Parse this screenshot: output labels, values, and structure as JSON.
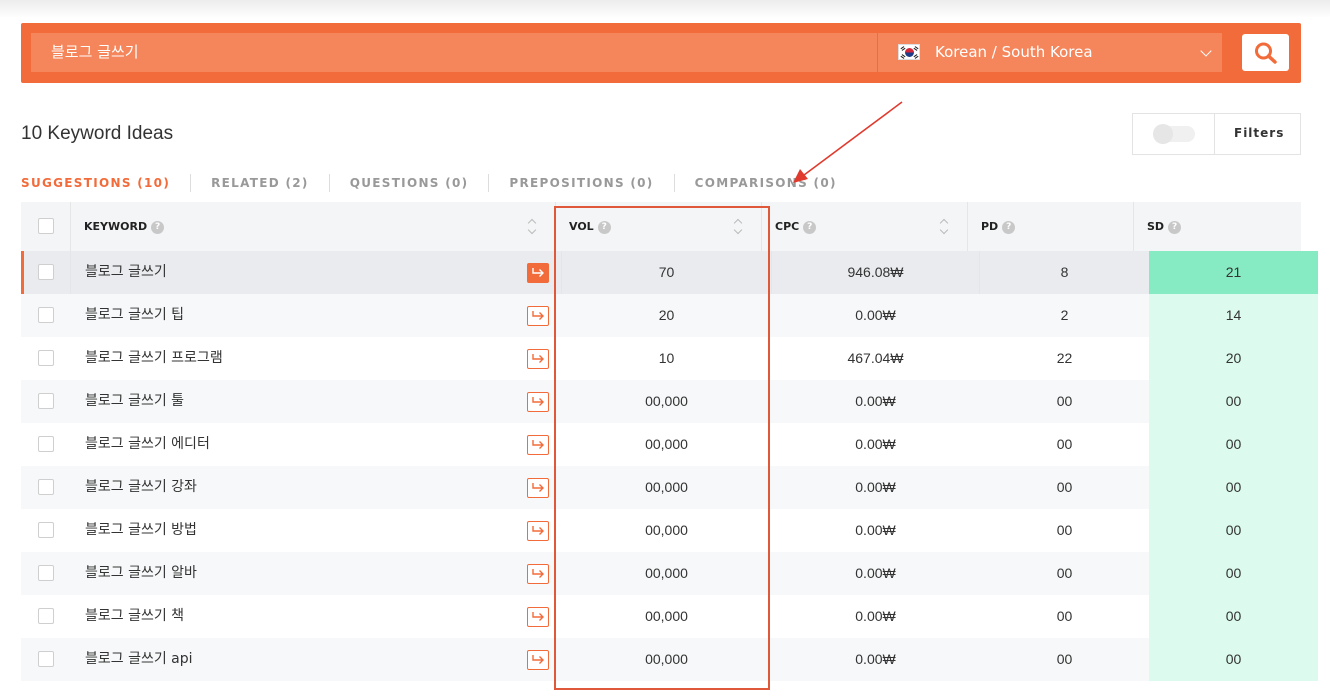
{
  "search": {
    "query": "블로그 글쓰기",
    "language": "Korean / South Korea"
  },
  "header": {
    "title": "10 Keyword Ideas",
    "filters_label": "Filters"
  },
  "tabs": [
    {
      "label": "SUGGESTIONS (10)",
      "active": true
    },
    {
      "label": "RELATED (2)",
      "active": false
    },
    {
      "label": "QUESTIONS (0)",
      "active": false
    },
    {
      "label": "PREPOSITIONS (0)",
      "active": false
    },
    {
      "label": "COMPARISONS (0)",
      "active": false
    }
  ],
  "table": {
    "columns": {
      "keyword": "KEYWORD",
      "vol": "VOL",
      "cpc": "CPC",
      "pd": "PD",
      "sd": "SD"
    },
    "rows": [
      {
        "keyword": "블로그 글쓰기",
        "vol": "70",
        "cpc": "946.08₩",
        "pd": "8",
        "sd": "21"
      },
      {
        "keyword": "블로그 글쓰기 팁",
        "vol": "20",
        "cpc": "0.00₩",
        "pd": "2",
        "sd": "14"
      },
      {
        "keyword": "블로그 글쓰기 프로그램",
        "vol": "10",
        "cpc": "467.04₩",
        "pd": "22",
        "sd": "20"
      },
      {
        "keyword": "블로그 글쓰기 툴",
        "vol": "00,000",
        "cpc": "0.00₩",
        "pd": "00",
        "sd": "00"
      },
      {
        "keyword": "블로그 글쓰기 에디터",
        "vol": "00,000",
        "cpc": "0.00₩",
        "pd": "00",
        "sd": "00"
      },
      {
        "keyword": "블로그 글쓰기 강좌",
        "vol": "00,000",
        "cpc": "0.00₩",
        "pd": "00",
        "sd": "00"
      },
      {
        "keyword": "블로그 글쓰기 방법",
        "vol": "00,000",
        "cpc": "0.00₩",
        "pd": "00",
        "sd": "00"
      },
      {
        "keyword": "블로그 글쓰기 알바",
        "vol": "00,000",
        "cpc": "0.00₩",
        "pd": "00",
        "sd": "00"
      },
      {
        "keyword": "블로그 글쓰기 책",
        "vol": "00,000",
        "cpc": "0.00₩",
        "pd": "00",
        "sd": "00"
      },
      {
        "keyword": "블로그 글쓰기 api",
        "vol": "00,000",
        "cpc": "0.00₩",
        "pd": "00",
        "sd": "00"
      }
    ]
  },
  "colors": {
    "accent": "#f26b3a",
    "sd_strong": "#86ebc2",
    "sd_light": "#dcfaee"
  },
  "icons": {
    "search": "search-icon",
    "flag": "south-korea-flag-icon",
    "goto": "arrow-right-icon",
    "help": "question-mark-icon",
    "sort": "sort-icon"
  }
}
